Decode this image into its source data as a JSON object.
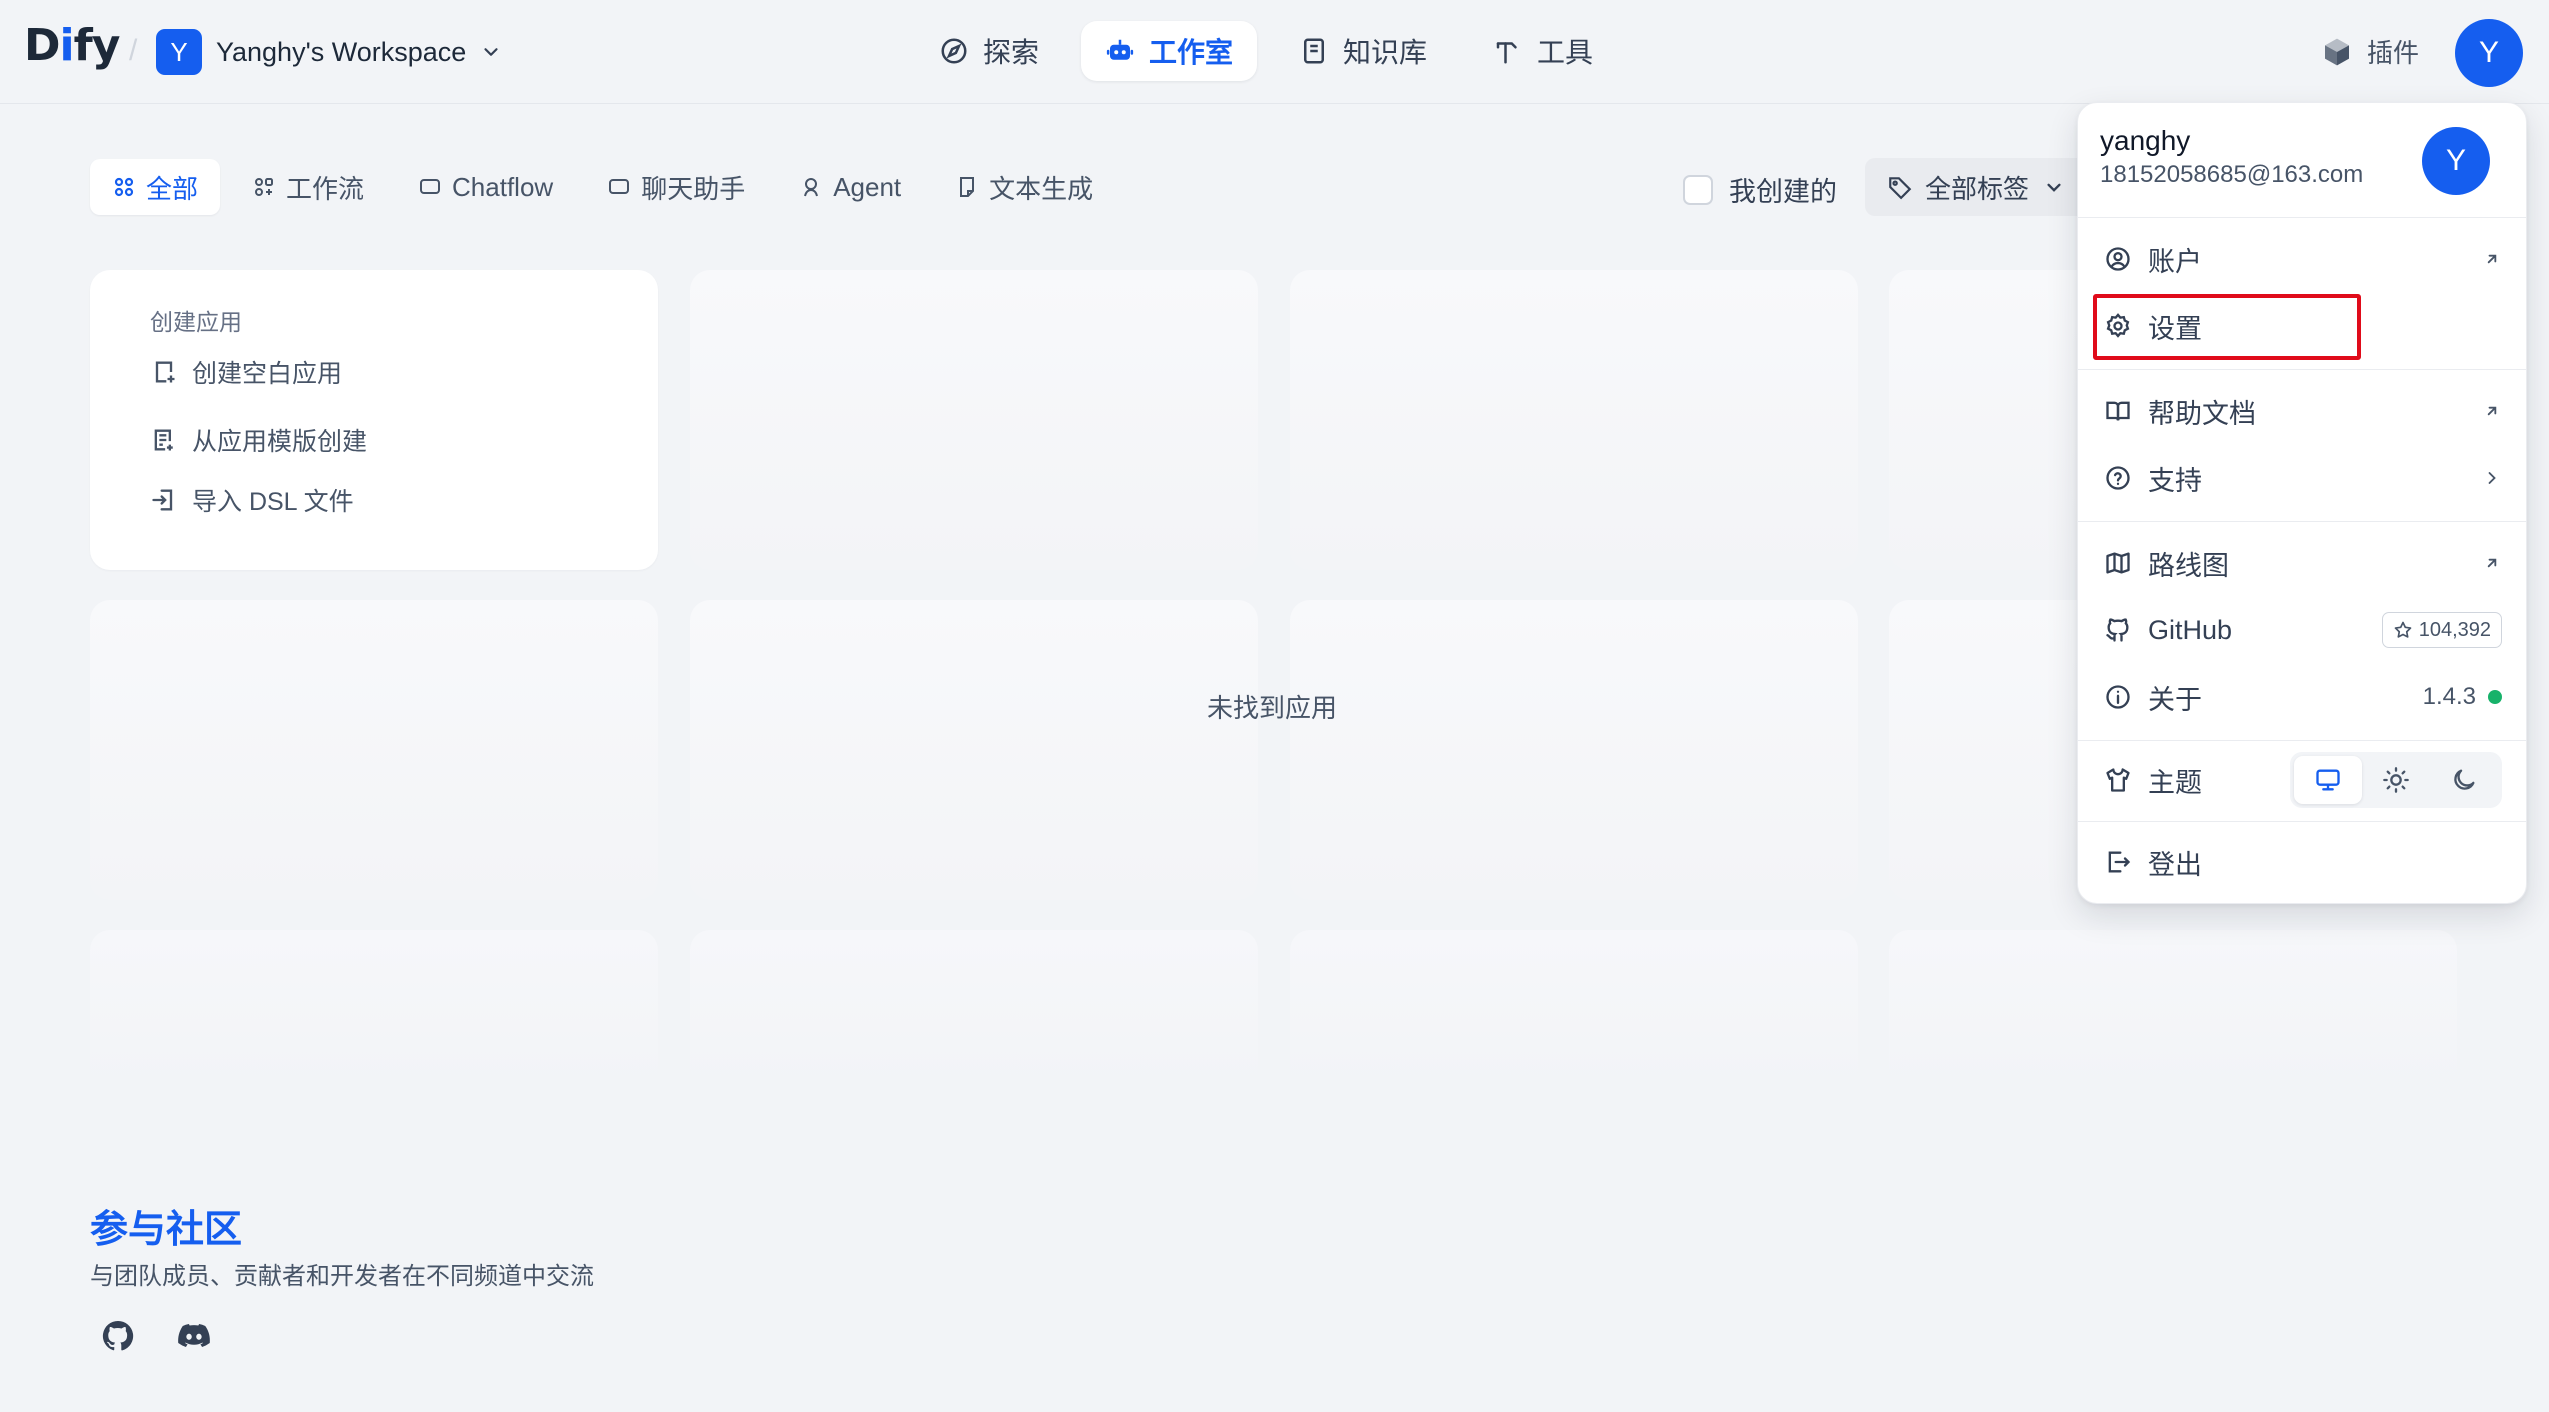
{
  "header": {
    "logo": "Dify",
    "workspace_initial": "Y",
    "workspace_name": "Yanghy's Workspace",
    "nav": [
      {
        "label": "探索",
        "icon": "compass-icon"
      },
      {
        "label": "工作室",
        "icon": "robot-icon",
        "active": true
      },
      {
        "label": "知识库",
        "icon": "book-icon"
      },
      {
        "label": "工具",
        "icon": "hammer-icon"
      }
    ],
    "plugin_label": "插件",
    "avatar_initial": "Y"
  },
  "filters": {
    "tabs": [
      {
        "label": "全部",
        "icon": "grid-icon",
        "active": true
      },
      {
        "label": "工作流",
        "icon": "workflow-icon"
      },
      {
        "label": "Chatflow",
        "icon": "chat-icon"
      },
      {
        "label": "聊天助手",
        "icon": "chat-bubble-icon"
      },
      {
        "label": "Agent",
        "icon": "agent-icon"
      },
      {
        "label": "文本生成",
        "icon": "document-icon"
      }
    ],
    "mine_label": "我创建的",
    "tags_label": "全部标签"
  },
  "create_card": {
    "title": "创建应用",
    "items": [
      "创建空白应用",
      "从应用模版创建",
      "导入 DSL 文件"
    ]
  },
  "empty_text": "未找到应用",
  "community": {
    "title": "参与社区",
    "subtitle": "与团队成员、贡献者和开发者在不同频道中交流"
  },
  "account_menu": {
    "user_name": "yanghy",
    "email": "18152058685@163.com",
    "avatar_initial": "Y",
    "items": {
      "account": "账户",
      "settings": "设置",
      "help_docs": "帮助文档",
      "support": "支持",
      "roadmap": "路线图",
      "github": "GitHub",
      "github_stars": "104,392",
      "about": "关于",
      "version": "1.4.3",
      "theme": "主题",
      "logout": "登出"
    },
    "theme_selected": "system"
  },
  "colors": {
    "accent": "#155eef",
    "highlight_box": "#e00b1a",
    "status_ok": "#17b26a"
  }
}
